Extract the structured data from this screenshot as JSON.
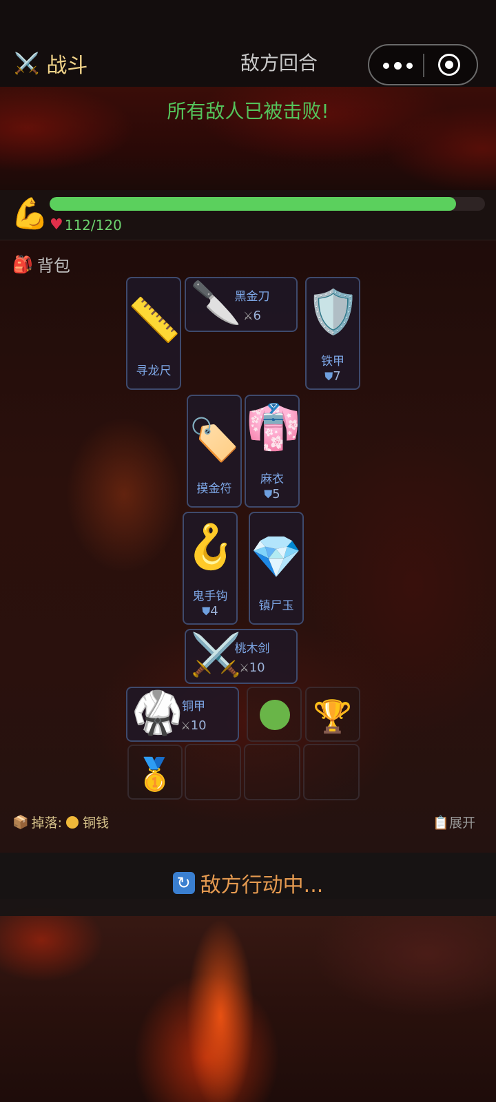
{
  "header": {
    "title_icon": "crossed-swords-icon",
    "title": "战斗",
    "turn_status": "敌方回合"
  },
  "banner": {
    "message": "所有敌人已被击败!"
  },
  "player": {
    "portrait_icon": "flexed-biceps-icon",
    "hp_current": 112,
    "hp_max": 120,
    "hp_fraction": 0.933,
    "hp_text": "112/120",
    "hp_color": "#5bd05d"
  },
  "backpack": {
    "label": "背包",
    "label_icon": "backpack-icon",
    "items": {
      "ruler": {
        "icon": "ruler-icon",
        "emoji": "📏",
        "name": "寻龙尺"
      },
      "knife": {
        "icon": "kitchen-knife-icon",
        "emoji": "🔪",
        "name": "黑金刀",
        "stat": "6",
        "stat_type": "attack"
      },
      "shield": {
        "icon": "shield-icon",
        "emoji": "🛡️",
        "name": "铁甲",
        "stat": "7",
        "stat_type": "defense"
      },
      "tag": {
        "icon": "label-tag-icon",
        "emoji": "🏷️",
        "name": "摸金符"
      },
      "kimono": {
        "icon": "kimono-icon",
        "emoji": "👘",
        "name": "麻衣",
        "stat": "5",
        "stat_type": "defense"
      },
      "hook": {
        "icon": "hook-icon",
        "emoji": "🪝",
        "name": "鬼手钩",
        "stat": "4",
        "stat_type": "defense"
      },
      "gem": {
        "icon": "gem-icon",
        "emoji": "💎",
        "name": "镇尸玉"
      },
      "sword": {
        "icon": "crossed-swords-icon",
        "emoji": "⚔️",
        "name": "桃木剑",
        "stat": "10",
        "stat_type": "attack"
      },
      "gi": {
        "icon": "martial-arts-uniform-icon",
        "emoji": "🥋",
        "name": "铜甲",
        "stat": "10",
        "stat_type": "attack"
      },
      "orb": {
        "icon": "green-circle-icon",
        "emoji": "🟢"
      },
      "trophy": {
        "icon": "trophy-icon",
        "emoji": "🏆"
      },
      "medal": {
        "icon": "first-place-medal-icon",
        "emoji": "🥇"
      }
    }
  },
  "drop": {
    "icon": "package-icon",
    "label": "掉落:",
    "coin_icon": "coin-icon",
    "item": "铜钱",
    "expand_label": "展开",
    "expand_icon": "clipboard-icon"
  },
  "footer": {
    "icon": "refresh-icon",
    "status": "敌方行动中..."
  }
}
